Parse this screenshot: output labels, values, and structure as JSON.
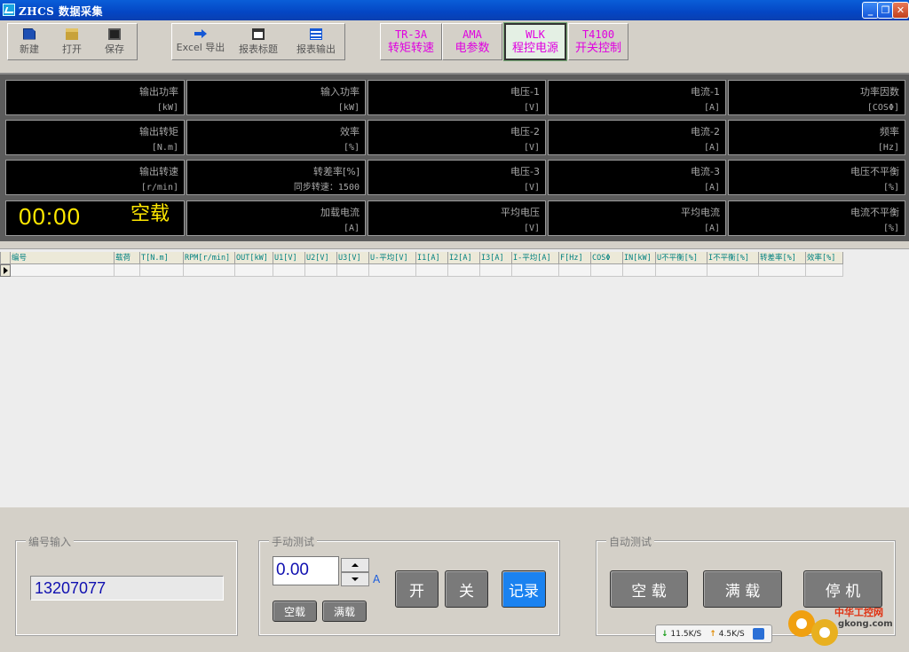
{
  "window": {
    "title": "ZHCS 数据采集",
    "min": "_",
    "max": "❐",
    "close": "✕"
  },
  "toolbar": {
    "file_buttons": [
      {
        "label": "新建",
        "icon": "new-file-icon"
      },
      {
        "label": "打开",
        "icon": "open-folder-icon"
      },
      {
        "label": "保存",
        "icon": "save-disk-icon"
      }
    ],
    "report_buttons": [
      {
        "label": "Excel 导出",
        "icon": "export-arrow-icon"
      },
      {
        "label": "报表标题",
        "icon": "report-header-icon"
      },
      {
        "label": "报表输出",
        "icon": "report-output-icon"
      }
    ],
    "modules": [
      {
        "line1": "TR-3A",
        "line2": "转矩转速"
      },
      {
        "line1": "AMA",
        "line2": "电参数"
      },
      {
        "line1": "WLK",
        "line2": "程控电源",
        "active": true
      },
      {
        "line1": "T4100",
        "line2": "开关控制"
      }
    ]
  },
  "measurements": {
    "rows": [
      [
        {
          "label": "输出功率",
          "unit": "[kW]"
        },
        {
          "label": "输入功率",
          "unit": "[kW]"
        },
        {
          "label": "电压-1",
          "unit": "[V]"
        },
        {
          "label": "电流-1",
          "unit": "[A]"
        },
        {
          "label": "功率因数",
          "unit": "[COSΦ]"
        }
      ],
      [
        {
          "label": "输出转矩",
          "unit": "[N.m]"
        },
        {
          "label": "效率",
          "unit": "[%]"
        },
        {
          "label": "电压-2",
          "unit": "[V]"
        },
        {
          "label": "电流-2",
          "unit": "[A]"
        },
        {
          "label": "频率",
          "unit": "[Hz]"
        }
      ],
      [
        {
          "label": "输出转速",
          "unit": "[r/min]"
        },
        {
          "label": "转差率[%]",
          "unit": "同步转速：1500"
        },
        {
          "label": "电压-3",
          "unit": "[V]"
        },
        {
          "label": "电流-3",
          "unit": "[A]"
        },
        {
          "label": "电压不平衡",
          "unit": "[%]"
        }
      ],
      [
        {
          "label": "",
          "unit": ""
        },
        {
          "label": "加载电流",
          "unit": "[A]"
        },
        {
          "label": "平均电压",
          "unit": "[V]"
        },
        {
          "label": "平均电流",
          "unit": "[A]"
        },
        {
          "label": "电流不平衡",
          "unit": "[%]"
        }
      ]
    ],
    "time": "00:00",
    "mode": "空载"
  },
  "grid": {
    "columns": [
      "编号",
      "载荷",
      "T[N.m]",
      "RPM[r/min]",
      "OUT[kW]",
      "U1[V]",
      "U2[V]",
      "U3[V]",
      "U-平均[V]",
      "I1[A]",
      "I2[A]",
      "I3[A]",
      "I-平均[A]",
      "F[Hz]",
      "COSΦ",
      "IN[kW]",
      "U不平衡[%]",
      "I不平衡[%]",
      "转差率[%]",
      "效率[%]"
    ]
  },
  "id_input": {
    "legend": "编号输入",
    "value": "13207077"
  },
  "manual": {
    "legend": "手动测试",
    "value": "0.00",
    "unit": "A",
    "no_load": "空载",
    "full_load": "满载",
    "on": "开",
    "off": "关",
    "record": "记录"
  },
  "auto": {
    "legend": "自动测试",
    "no_load": "空  载",
    "full_load": "满  载",
    "stop": "停  机"
  },
  "tray": {
    "down": "11.5K/S",
    "up": "4.5K/S"
  },
  "watermark": {
    "cn": "中华工控网",
    "url": "gkong.com"
  }
}
